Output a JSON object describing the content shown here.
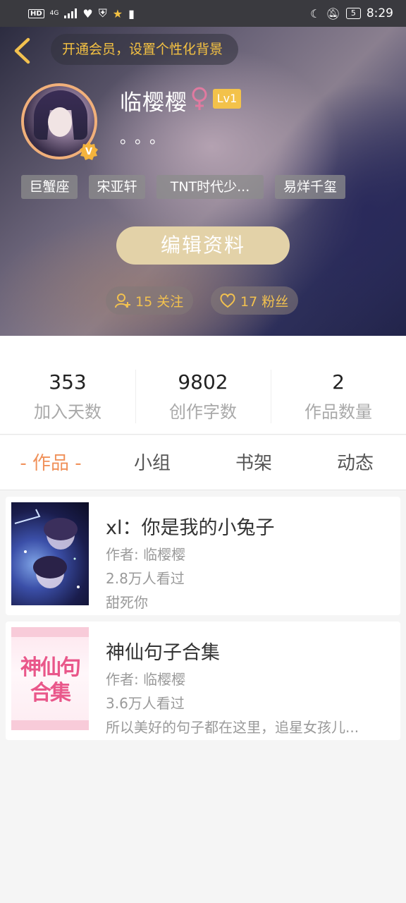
{
  "status_bar": {
    "hd": "HD",
    "network": "4G",
    "battery": "5",
    "time": "8:29"
  },
  "header": {
    "vip_banner": "开通会员，设置个性化背景",
    "username": "临樱樱",
    "gender_symbol": "♀",
    "level": "Lv1",
    "bio": "。。。",
    "tags": [
      "巨蟹座",
      "宋亚轩",
      "TNT时代少...",
      "易烊千玺"
    ],
    "edit_button": "编辑资料",
    "following": "15 关注",
    "followers": "17 粉丝",
    "accent_color": "#f3c24a"
  },
  "stats": [
    {
      "value": "353",
      "label": "加入天数"
    },
    {
      "value": "9802",
      "label": "创作字数"
    },
    {
      "value": "2",
      "label": "作品数量"
    }
  ],
  "tabs": [
    {
      "label": "- 作品 -",
      "active": true
    },
    {
      "label": "小组",
      "active": false
    },
    {
      "label": "书架",
      "active": false
    },
    {
      "label": "动态",
      "active": false
    }
  ],
  "works": [
    {
      "title": "xl：你是我的小兔子",
      "author": "作者: 临樱樱",
      "views": "2.8万人看过",
      "desc": "甜死你"
    },
    {
      "title": "神仙句子合集",
      "author": "作者: 临樱樱",
      "views": "3.6万人看过",
      "desc": "所以美好的句子都在这里，追星女孩儿...",
      "cover_text": "神仙句合集"
    }
  ]
}
